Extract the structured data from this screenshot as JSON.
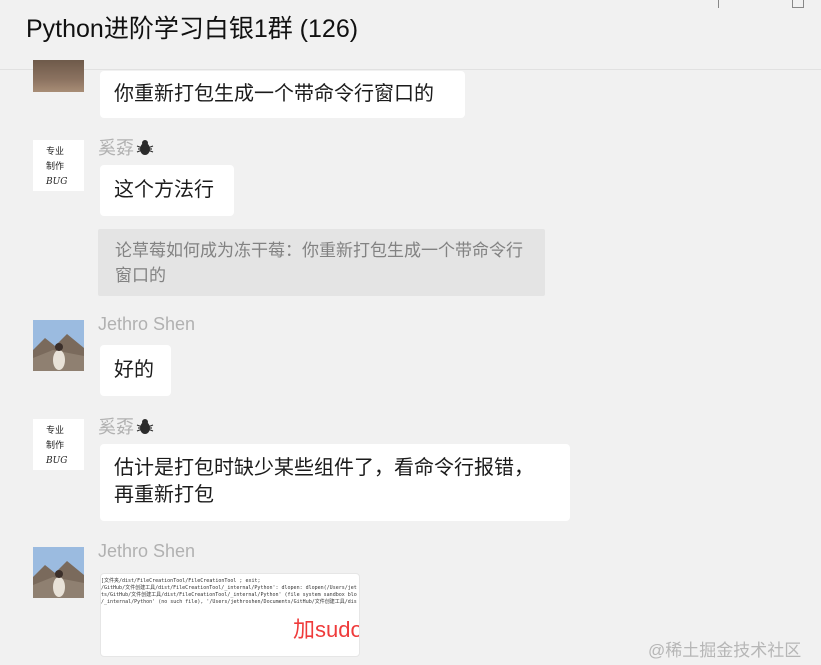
{
  "window": {
    "title": "Python进阶学习白银1群 (126)"
  },
  "messages": [
    {
      "text": "你重新打包生成一个带命令行窗口的"
    },
    {
      "sender": "奚孬",
      "text": "这个方法行",
      "quote": "论草莓如何成为冻干莓：你重新打包生成一个带命令行窗口的"
    },
    {
      "sender": "Jethro Shen",
      "text": "好的"
    },
    {
      "sender": "奚孬",
      "text_line1": "估计是打包时缺少某些组件了，看命令行报错，",
      "text_line2": "再重新打包"
    },
    {
      "sender": "Jethro Shen",
      "image": {
        "lines": [
          "[文件夹/dist/FileCreationTool/FileCreationTool ; exit;",
          "/GitHub/文件创建工具/dist/FileCreationTool/_internal/Python': dlopen: dlopen(/Users/jet",
          "ts/GitHub/文件创建工具/dist/FileCreationTool/_internal/Python' (file system sandbox blo",
          "/_internal/Python' (no such file), '/Users/jethroshen/Documents/GitHub/文件创建工具/dis"
        ],
        "annotation": "加sudo 更改权限"
      }
    }
  ],
  "avatar_bug": {
    "line1": "专业",
    "line2": "制作",
    "line3": "BUG"
  },
  "watermark": "@稀土掘金技术社区"
}
